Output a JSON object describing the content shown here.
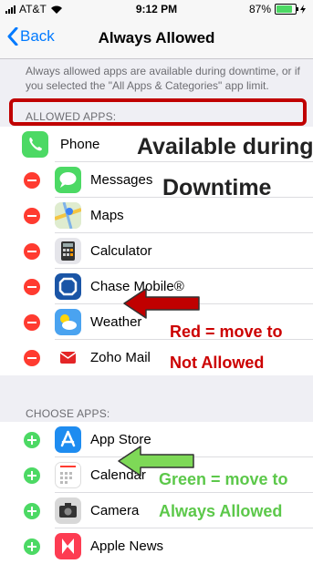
{
  "status_bar": {
    "carrier": "AT&T",
    "time": "9:12 PM",
    "battery": "87%",
    "battery_level": 0.87
  },
  "nav": {
    "back_label": "Back",
    "title": "Always Allowed"
  },
  "description": "Always allowed apps are available during downtime, or if you selected the \"All Apps & Categories\" app limit.",
  "allowed_section": {
    "header": "ALLOWED APPS:",
    "items": [
      {
        "name": "Phone",
        "icon": "phone-icon",
        "control": "none"
      },
      {
        "name": "Messages",
        "icon": "messages-icon",
        "control": "remove"
      },
      {
        "name": "Maps",
        "icon": "maps-icon",
        "control": "remove"
      },
      {
        "name": "Calculator",
        "icon": "calculator-icon",
        "control": "remove"
      },
      {
        "name": "Chase Mobile®",
        "icon": "chase-icon",
        "control": "remove"
      },
      {
        "name": "Weather",
        "icon": "weather-icon",
        "control": "remove"
      },
      {
        "name": "Zoho Mail",
        "icon": "zoho-mail-icon",
        "control": "remove"
      }
    ]
  },
  "choose_section": {
    "header": "CHOOSE APPS:",
    "items": [
      {
        "name": "App Store",
        "icon": "app-store-icon",
        "control": "add"
      },
      {
        "name": "Calendar",
        "icon": "calendar-icon",
        "control": "add"
      },
      {
        "name": "Camera",
        "icon": "camera-icon",
        "control": "add"
      },
      {
        "name": "Apple News",
        "icon": "news-icon",
        "control": "add"
      }
    ]
  },
  "annotations": {
    "available_line1": "Available during",
    "available_line2": "Downtime",
    "red_line1": "Red = move to",
    "red_line2": "Not Allowed",
    "green_line1": "Green = move to",
    "green_line2": "Always Allowed"
  },
  "colors": {
    "ios_blue": "#007aff",
    "remove_red": "#ff3b30",
    "add_green": "#4cd964",
    "annotation_red": "#cc0000",
    "annotation_green": "#5cc84a"
  }
}
